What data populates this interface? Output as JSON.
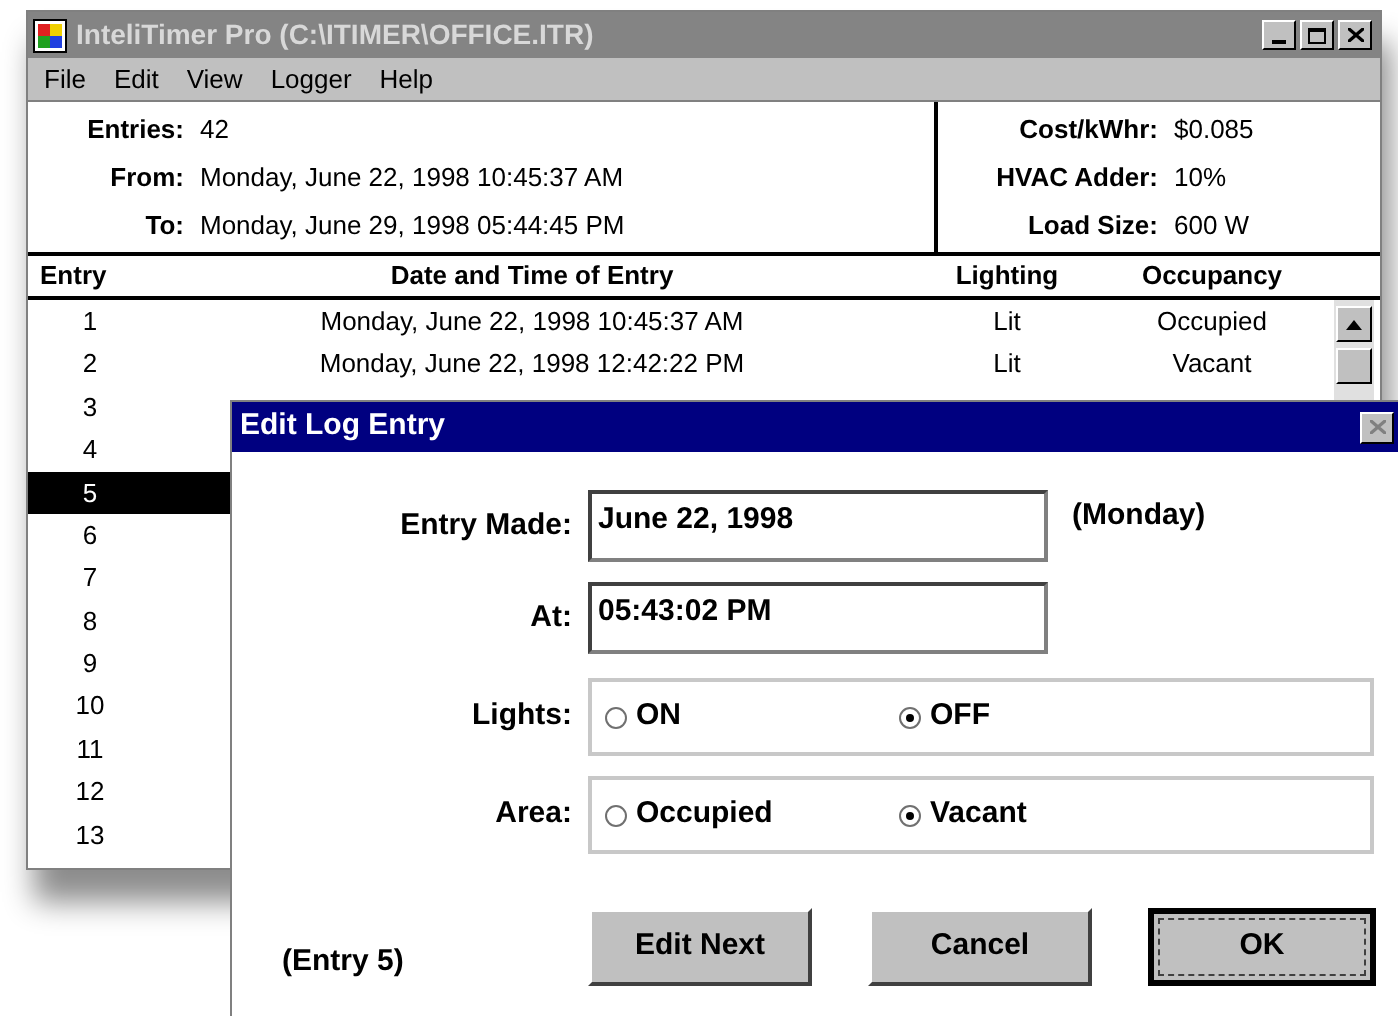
{
  "window": {
    "title": "InteliTimer Pro (C:\\ITIMER\\OFFICE.ITR)"
  },
  "menu": [
    {
      "label": "File"
    },
    {
      "label": "Edit"
    },
    {
      "label": "View"
    },
    {
      "label": "Logger"
    },
    {
      "label": "Help"
    }
  ],
  "summary_left": [
    {
      "label": "Entries:",
      "value": "42"
    },
    {
      "label": "From:",
      "value": "Monday, June 22, 1998 10:45:37 AM"
    },
    {
      "label": "To:",
      "value": "Monday, June 29, 1998 05:44:45 PM"
    }
  ],
  "summary_right": [
    {
      "label": "Cost/kWhr:",
      "value": "$0.085"
    },
    {
      "label": "HVAC Adder:",
      "value": "10%"
    },
    {
      "label": "Load Size:",
      "value": "600 W"
    }
  ],
  "table": {
    "columns": [
      "Entry",
      "Date and Time of Entry",
      "Lighting",
      "Occupancy"
    ],
    "rows": [
      {
        "entry": "1",
        "date": "Monday, June 22, 1998 10:45:37 AM",
        "lighting": "Lit",
        "occupancy": "Occupied",
        "selected": false
      },
      {
        "entry": "2",
        "date": "Monday, June 22, 1998 12:42:22 PM",
        "lighting": "Lit",
        "occupancy": "Vacant",
        "selected": false
      },
      {
        "entry": "3",
        "selected": false
      },
      {
        "entry": "4",
        "selected": false
      },
      {
        "entry": "5",
        "selected": true
      },
      {
        "entry": "6",
        "selected": false
      },
      {
        "entry": "7",
        "selected": false
      },
      {
        "entry": "8",
        "selected": false
      },
      {
        "entry": "9",
        "selected": false
      },
      {
        "entry": "10",
        "selected": false
      },
      {
        "entry": "11",
        "selected": false
      },
      {
        "entry": "12",
        "selected": false
      },
      {
        "entry": "13",
        "selected": false
      }
    ]
  },
  "dialog": {
    "title": "Edit Log Entry",
    "entry_made": {
      "label": "Entry Made:",
      "value": "June 22, 1998",
      "note": "(Monday)"
    },
    "at": {
      "label": "At:",
      "value": "05:43:02 PM"
    },
    "lights": {
      "label": "Lights:",
      "options": [
        {
          "label": "ON",
          "selected": false
        },
        {
          "label": "OFF",
          "selected": true
        }
      ]
    },
    "area": {
      "label": "Area:",
      "options": [
        {
          "label": "Occupied",
          "selected": false
        },
        {
          "label": "Vacant",
          "selected": true
        }
      ]
    },
    "footer_note": "(Entry 5)",
    "buttons": [
      {
        "label": "Edit Next",
        "default": false
      },
      {
        "label": "Cancel",
        "default": false
      },
      {
        "label": "OK",
        "default": true
      }
    ]
  }
}
